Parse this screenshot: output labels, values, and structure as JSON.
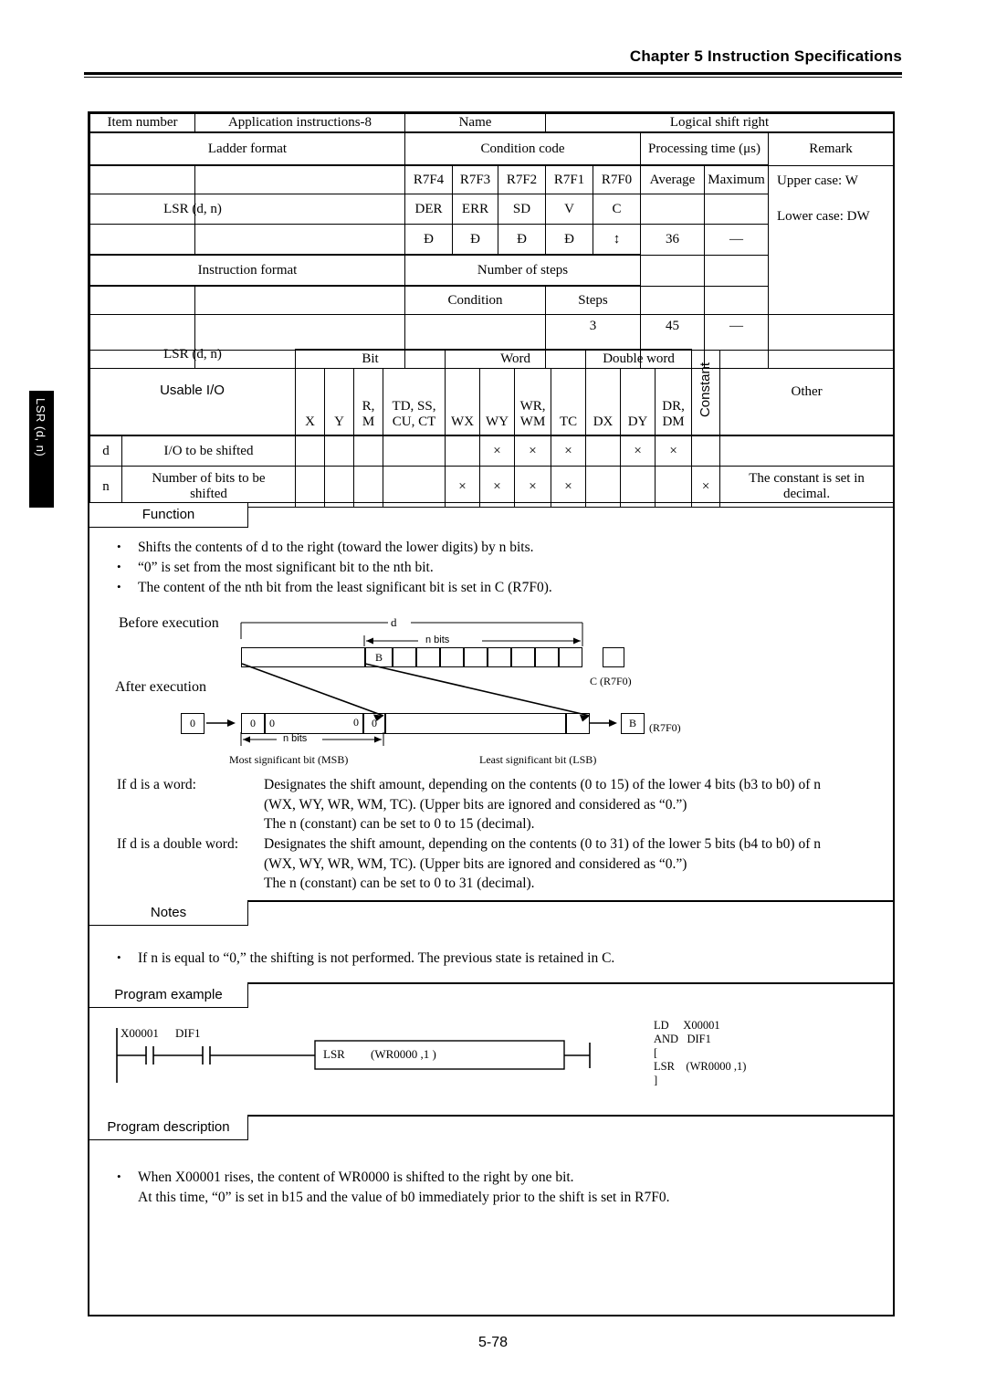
{
  "header": {
    "chapter": "Chapter 5  Instruction Specifications"
  },
  "side_tab": {
    "label": "LSR (d, n)"
  },
  "footer": {
    "page": "5-78"
  },
  "spec_table": {
    "item_number_label": "Item number",
    "item_number_value": "Application instructions-8",
    "name_label": "Name",
    "name_value": "Logical shift right",
    "ladder_format_label": "Ladder format",
    "condition_code_label": "Condition code",
    "processing_time_label": "Processing time (μs)",
    "remark_label": "Remark",
    "cc_registers": [
      "R7F4",
      "R7F3",
      "R7F2",
      "R7F1",
      "R7F0"
    ],
    "cc_names": [
      "DER",
      "ERR",
      "SD",
      "V",
      "C"
    ],
    "cc_effects": [
      "Ð",
      "Ð",
      "Ð",
      "Ð",
      "↕"
    ],
    "avg_label": "Average",
    "max_label": "Maximum",
    "ladder_mnemonic": "LSR (d, n)",
    "avg_value_1": "36",
    "max_value_1": "—",
    "remark_line1": "Upper case: W",
    "remark_line2": "Lower case: DW",
    "instruction_format_label": "Instruction format",
    "number_of_steps_label": "Number of steps",
    "condition_label": "Condition",
    "steps_label": "Steps",
    "instr_mnemonic": "LSR (d, n)",
    "condition_value": "",
    "steps_value": "3",
    "avg_value_2": "45",
    "max_value_2": "—"
  },
  "usable_io": {
    "title": "Usable I/O",
    "group_bit": "Bit",
    "group_word": "Word",
    "group_double_word": "Double word",
    "group_constant": "Constant",
    "group_other": "Other",
    "columns": [
      {
        "id": "X",
        "line1": "",
        "line2": "X"
      },
      {
        "id": "Y",
        "line1": "",
        "line2": "Y"
      },
      {
        "id": "RM",
        "line1": "R,",
        "line2": "M"
      },
      {
        "id": "TD",
        "line1": "TD, SS,",
        "line2": "CU, CT"
      },
      {
        "id": "WX",
        "line1": "",
        "line2": "WX"
      },
      {
        "id": "WY",
        "line1": "",
        "line2": "WY"
      },
      {
        "id": "WM",
        "line1": "WR,",
        "line2": "WM"
      },
      {
        "id": "TC",
        "line1": "",
        "line2": "TC"
      },
      {
        "id": "DX",
        "line1": "",
        "line2": "DX"
      },
      {
        "id": "DY",
        "line1": "",
        "line2": "DY"
      },
      {
        "id": "DM",
        "line1": "DR,",
        "line2": "DM"
      }
    ],
    "rows": [
      {
        "key": "d",
        "desc": "I/O to be shifted",
        "marks": [
          "",
          "",
          "",
          "",
          "",
          "×",
          "×",
          "×",
          "",
          "×",
          "×"
        ],
        "constant": "",
        "other": ""
      },
      {
        "key": "n",
        "desc_line1": "Number of bits to be",
        "desc_line2": "shifted",
        "marks": [
          "",
          "",
          "",
          "",
          "×",
          "×",
          "×",
          "×",
          "",
          "",
          ""
        ],
        "constant": "×",
        "other_line1": "The constant is set in",
        "other_line2": "decimal."
      }
    ]
  },
  "function": {
    "label": "Function",
    "bullets": [
      "Shifts the contents of d to the right (toward the lower digits) by n bits.",
      "“0” is set from the most significant bit to the nth bit.",
      "The content of the nth bit from the least significant bit is set in C (R7F0)."
    ]
  },
  "diagram": {
    "before_label": "Before execution",
    "after_label": "After execution",
    "d_label": "d",
    "n_bits_top": "n bits",
    "n_bits_bottom": "n bits",
    "b_cell": "B",
    "c_flag_label": "C (R7F0)",
    "r7f0_label": "(R7F0)",
    "b_result": "B",
    "zero_in": "0",
    "zeros": [
      "0",
      "0",
      "0",
      "0"
    ],
    "msb_label": "Most significant bit (MSB)",
    "lsb_label": "Least significant bit (LSB)"
  },
  "word_rules": [
    {
      "label": "If d is a word:",
      "lines": [
        "Designates the shift amount, depending on the contents (0 to 15) of the lower 4 bits (b3 to b0) of n",
        "(WX, WY, WR, WM, TC).  (Upper bits are ignored and considered as “0.”)",
        "The n (constant) can be set to 0 to 15 (decimal)."
      ]
    },
    {
      "label": "If d is a double word:",
      "lines": [
        "Designates the shift amount, depending on the contents (0 to 31) of the lower 5 bits (b4 to b0) of n",
        "(WX, WY, WR, WM, TC). (Upper bits are ignored and considered as “0.”)",
        "The n (constant) can be set to 0 to 31 (decimal)."
      ]
    }
  ],
  "notes": {
    "label": "Notes",
    "bullets": [
      "If n is equal to “0,” the shifting is not performed.  The previous state is retained in C."
    ]
  },
  "program_example": {
    "label": "Program example",
    "ladder": {
      "contact1": "X00001",
      "contact2": "DIF1",
      "box_instr": "LSR",
      "box_operand": "(WR0000 ,1 )"
    },
    "mnemonic_lines": [
      "LD     X00001",
      "AND   DIF1",
      "[",
      "LSR    (WR0000 ,1)",
      "]"
    ]
  },
  "program_description": {
    "label": "Program description",
    "bullets": [
      "When X00001 rises, the content of WR0000 is shifted to the right by one bit.",
      "At this time, “0” is set in b15 and the value of b0 immediately prior to the shift is set in R7F0."
    ]
  }
}
